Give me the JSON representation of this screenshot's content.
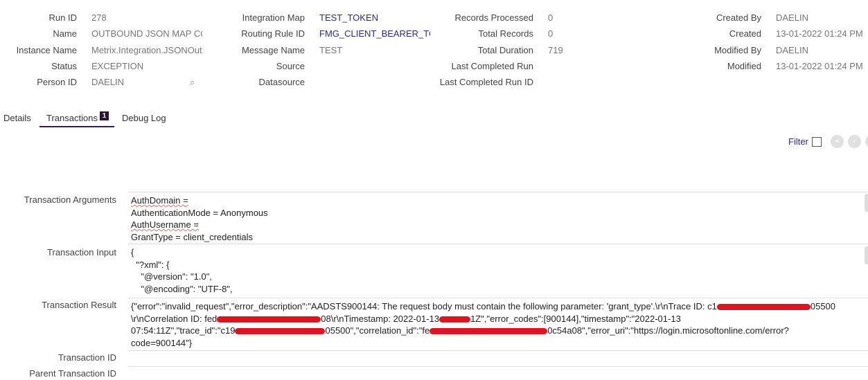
{
  "header": {
    "col1": [
      {
        "label": "Run ID",
        "value": "278"
      },
      {
        "label": "Name",
        "value": "OUTBOUND JSON MAP CO"
      },
      {
        "label": "Instance Name",
        "value": "Metrix.Integration.JSONOut"
      },
      {
        "label": "Status",
        "value": "EXCEPTION"
      },
      {
        "label": "Person ID",
        "value": "DAELIN"
      }
    ],
    "col2": [
      {
        "label": "Integration Map",
        "value": "TEST_TOKEN"
      },
      {
        "label": "Routing Rule ID",
        "value": "FMG_CLIENT_BEARER_TOKE"
      },
      {
        "label": "Message Name",
        "value": "TEST"
      },
      {
        "label": "Source",
        "value": ""
      },
      {
        "label": "Datasource",
        "value": ""
      }
    ],
    "col3": [
      {
        "label": "Records Processed",
        "value": "0"
      },
      {
        "label": "Total Records",
        "value": "0"
      },
      {
        "label": "Total Duration",
        "value": "719"
      },
      {
        "label": "Last Completed Run",
        "value": ""
      },
      {
        "label": "Last Completed Run ID",
        "value": ""
      }
    ],
    "col4": [
      {
        "label": "Created By",
        "value": "DAELIN"
      },
      {
        "label": "Created",
        "value": "13-01-2022 01:24 PM"
      },
      {
        "label": "Modified By",
        "value": "DAELIN"
      },
      {
        "label": "Modified",
        "value": "13-01-2022 01:24 PM"
      }
    ]
  },
  "tabs": [
    {
      "label": "Details"
    },
    {
      "label": "Transactions",
      "badge": "1",
      "active": true
    },
    {
      "label": "Debug Log"
    }
  ],
  "filter_label": "Filter",
  "fields": {
    "arguments_label": "Transaction Arguments",
    "arguments": [
      "AuthDomain =",
      "AuthenticationMode = Anonymous",
      "AuthUsername =",
      "GrantType = client_credentials"
    ],
    "input_label": "Transaction Input",
    "input": [
      "{",
      "  \"?xml\": {",
      "    \"@version\": \"1.0\",",
      "    \"@encoding\": \"UTF-8\","
    ],
    "result_label": "Transaction Result",
    "result": {
      "p1": "{\"error\":\"invalid_request\",\"error_description\":\"AADSTS900144: The request body must contain the following parameter: 'grant_type'.\\r\\nTrace ID: c1",
      "p2": "05500",
      "p3": "\\r\\nCorrelation ID: fed",
      "p4": "08\\r\\nTimestamp: 2022-01-13",
      "p5": "1Z\",\"error_codes\":[900144],\"timestamp\":\"2022-01-13",
      "p6": "07:54:11Z\",\"trace_id\":\"c19",
      "p7": "05500\",\"correlation_id\":\"fe",
      "p8": "0c54a08\",\"error_uri\":\"https://login.microsoftonline.com/error?",
      "p9": "code=900144\"}"
    },
    "transaction_id_label": "Transaction ID",
    "parent_label": "Parent Transaction ID"
  },
  "colors": {
    "link": "#2a2a8c",
    "tab_underline": "#3b1a4a",
    "redaction": "#e0141e"
  }
}
